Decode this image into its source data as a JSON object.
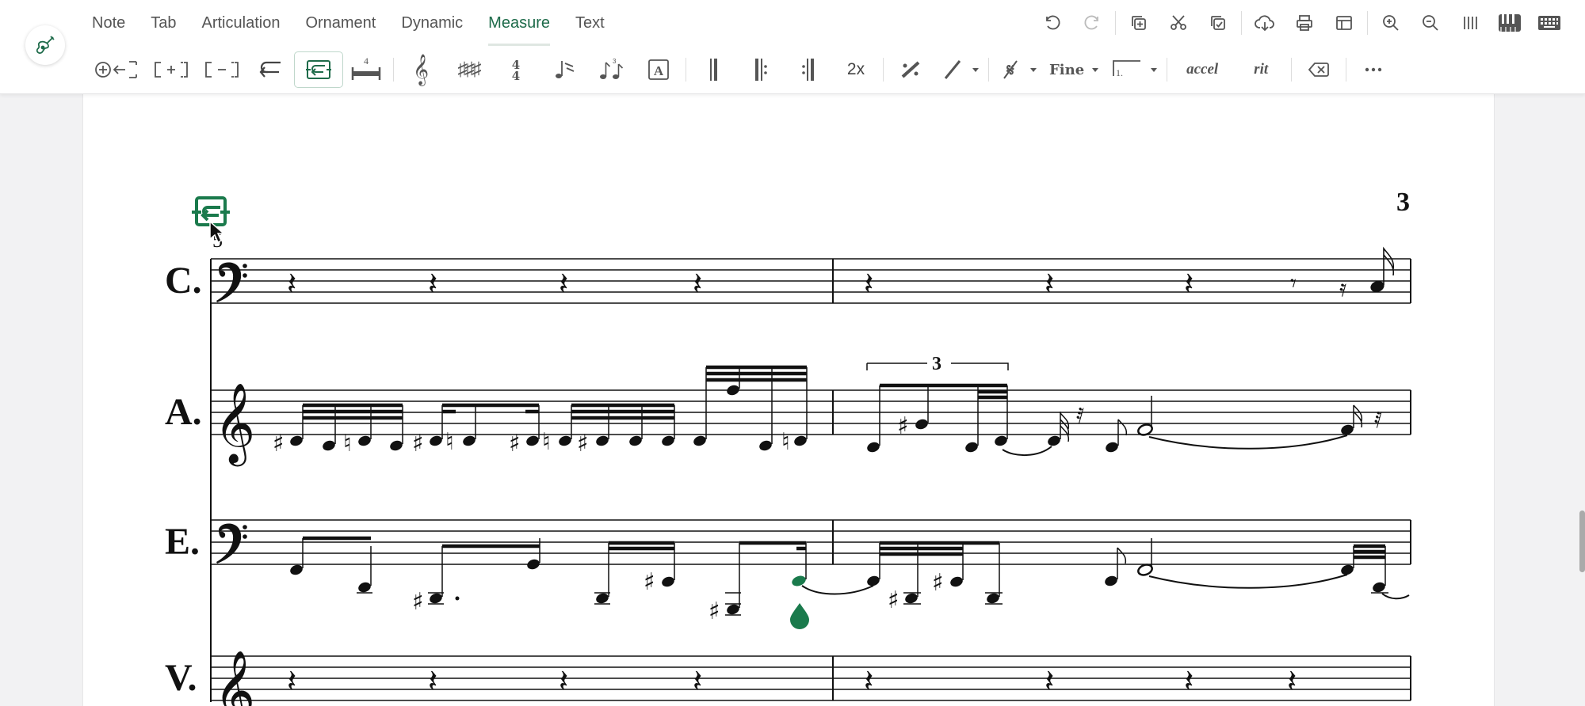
{
  "tabs": [
    {
      "label": "Note",
      "active": false
    },
    {
      "label": "Tab",
      "active": false
    },
    {
      "label": "Articulation",
      "active": false
    },
    {
      "label": "Ornament",
      "active": false
    },
    {
      "label": "Dynamic",
      "active": false
    },
    {
      "label": "Measure",
      "active": true
    },
    {
      "label": "Text",
      "active": false
    }
  ],
  "right_tools": [
    "undo-icon",
    "redo-icon",
    "duplicate-icon",
    "cut-icon",
    "paste-icon",
    "export-icon",
    "print-icon",
    "layout-icon",
    "zoom-in-icon",
    "zoom-out-icon",
    "barlines-view-icon",
    "piano-icon",
    "keyboard-icon"
  ],
  "measure_toolbar": {
    "insert_measure_icon": "insert-measure-icon",
    "add_measure_icon": "add-measure-icon",
    "remove_measure_icon": "remove-measure-icon",
    "line_break_icon": "line-break-icon",
    "system_break_icon": "system-break-icon",
    "measure_width_label": "4",
    "repeat_label": "2x",
    "fine_label": "Fine",
    "volta_label": "1.",
    "accel_label": "accel",
    "rit_label": "rit"
  },
  "score": {
    "measure_number": "5",
    "page_number": "3",
    "tuplet_label": "3",
    "staves": [
      {
        "abbr": "C.",
        "clef": "bass"
      },
      {
        "abbr": "A.",
        "clef": "treble"
      },
      {
        "abbr": "E.",
        "clef": "bass"
      },
      {
        "abbr": "V.",
        "clef": "treble"
      }
    ]
  },
  "colors": {
    "accent": "#1e6b4a",
    "selection": "#1a7a4c",
    "text": "#333333",
    "tab_active_underline": "#dfe7e2"
  }
}
